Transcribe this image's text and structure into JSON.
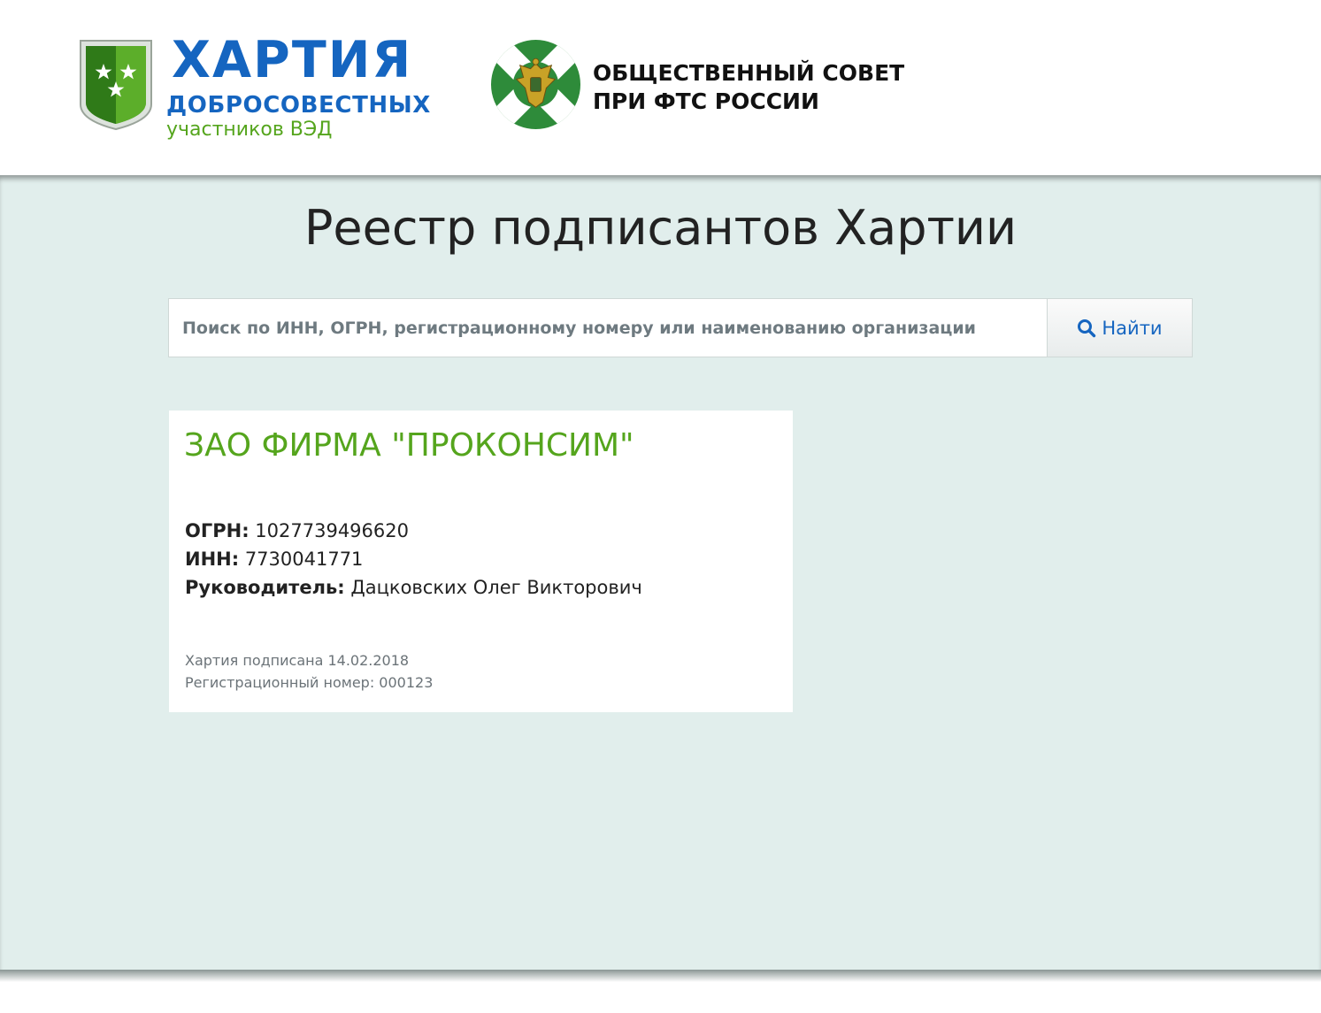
{
  "header": {
    "charter_logo": {
      "line1": "ХАРТИЯ",
      "line2": "ДОБРОСОВЕСТНЫХ",
      "line3": "участников ВЭД"
    },
    "council_logo": {
      "line1": "ОБЩЕСТВЕННЫЙ СОВЕТ",
      "line2": "ПРИ ФТС РОССИИ"
    }
  },
  "main": {
    "title": "Реестр подписантов Хартии",
    "search": {
      "placeholder": "Поиск по ИНН, ОГРН, регистрационному номеру или наименованию организации",
      "value": "",
      "button_label": "Найти",
      "button_icon": "search-icon"
    },
    "result": {
      "name": "ЗАО ФИРМА \"ПРОКОНСИМ\"",
      "ogrn_label": "ОГРН:",
      "ogrn": "1027739496620",
      "inn_label": "ИНН:",
      "inn": "7730041771",
      "head_label": "Руководитель:",
      "head": "Дацковских Олег Викторович",
      "signed": "Хартия подписана 14.02.2018",
      "reg_number": "Регистрационный номер: 000123"
    }
  },
  "colors": {
    "brand_blue": "#1565c0",
    "brand_green": "#55a51d",
    "band_background": "#e1eeec",
    "council_green": "#2e8b3a"
  }
}
